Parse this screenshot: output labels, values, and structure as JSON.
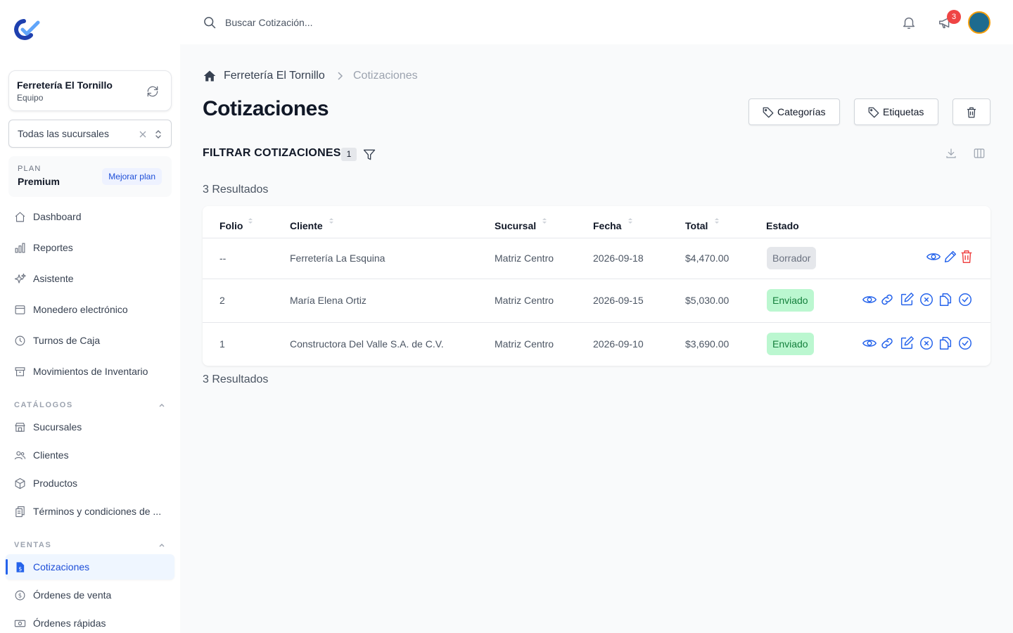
{
  "org": {
    "name": "Ferretería El Tornillo",
    "role": "Equipo"
  },
  "branch_select": {
    "value": "Todas las sucursales"
  },
  "plan": {
    "label": "PLAN",
    "name": "Premium",
    "upgrade_label": "Mejorar plan"
  },
  "nav": {
    "items": [
      {
        "label": "Dashboard",
        "icon": "home-icon"
      },
      {
        "label": "Reportes",
        "icon": "chart-bar-icon"
      },
      {
        "label": "Asistente",
        "icon": "sparkles-icon"
      },
      {
        "label": "Monedero electrónico",
        "icon": "wallet-icon"
      },
      {
        "label": "Turnos de Caja",
        "icon": "clock-icon"
      },
      {
        "label": "Movimientos de Inventario",
        "icon": "archive-icon"
      }
    ],
    "catalogs_label": "CATÁLOGOS",
    "catalogs": [
      {
        "label": "Sucursales",
        "icon": "store-icon"
      },
      {
        "label": "Clientes",
        "icon": "users-icon"
      },
      {
        "label": "Productos",
        "icon": "cube-icon"
      },
      {
        "label": "Términos y condiciones de ...",
        "icon": "document-copy-icon"
      }
    ],
    "sales_label": "VENTAS",
    "sales": [
      {
        "label": "Cotizaciones",
        "icon": "document-currency-icon",
        "active": true
      },
      {
        "label": "Órdenes de venta",
        "icon": "currency-circle-icon"
      },
      {
        "label": "Órdenes rápidas",
        "icon": "cash-icon"
      }
    ]
  },
  "topbar": {
    "search_placeholder": "Buscar Cotización...",
    "notification_count": "3"
  },
  "breadcrumb": {
    "home": "Ferretería El Tornillo",
    "current": "Cotizaciones"
  },
  "page": {
    "title": "Cotizaciones",
    "buttons": {
      "categories": "Categorías",
      "tags": "Etiquetas"
    },
    "filter_title": "FILTRAR COTIZACIONES",
    "filter_count": "1",
    "results_label": "3 Resultados"
  },
  "table": {
    "columns": [
      "Folio",
      "Cliente",
      "Sucursal",
      "Fecha",
      "Total",
      "Estado"
    ],
    "rows": [
      {
        "folio": "--",
        "cliente": "Ferretería La Esquina",
        "sucursal": "Matriz Centro",
        "fecha": "2026-09-18",
        "total": "$4,470.00",
        "estado": "Borrador"
      },
      {
        "folio": "2",
        "cliente": "María Elena Ortiz",
        "sucursal": "Matriz Centro",
        "fecha": "2026-09-15",
        "total": "$5,030.00",
        "estado": "Enviado"
      },
      {
        "folio": "1",
        "cliente": "Constructora Del Valle S.A. de C.V.",
        "sucursal": "Matriz Centro",
        "fecha": "2026-09-10",
        "total": "$3,690.00",
        "estado": "Enviado"
      }
    ]
  },
  "colors": {
    "accent": "#2563eb",
    "danger": "#ef4444",
    "sent_bg": "#bbf7d0",
    "draft_bg": "#e5e7eb"
  }
}
